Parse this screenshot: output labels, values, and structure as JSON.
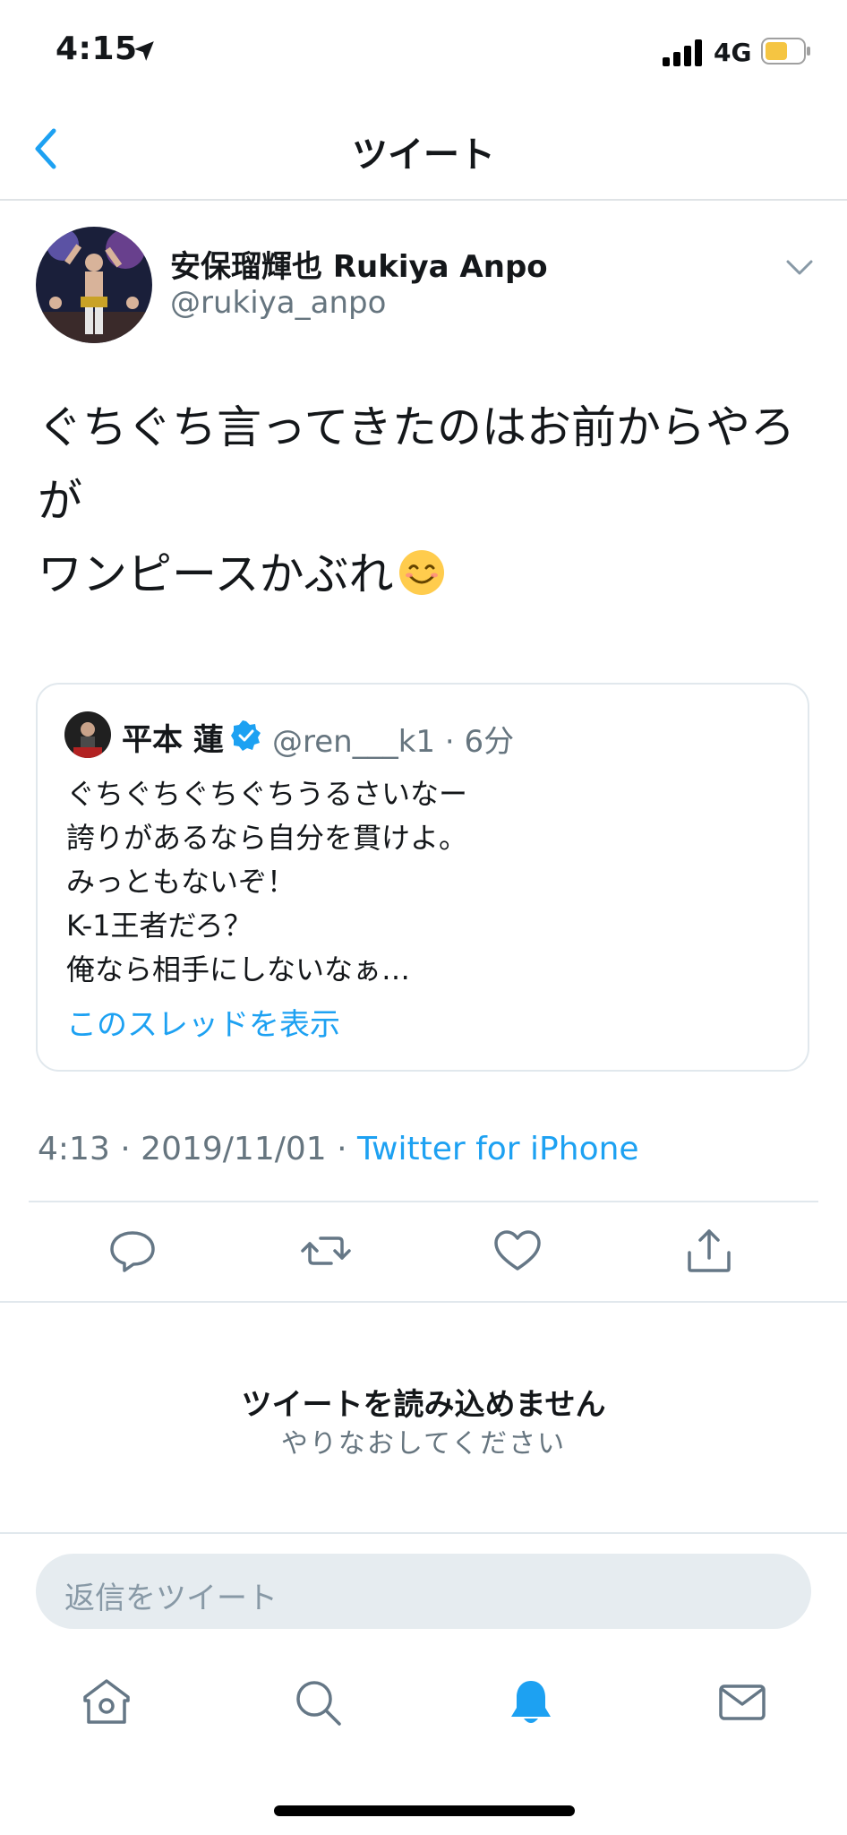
{
  "status_bar": {
    "time": "4:15",
    "network": "4G",
    "battery_color": "#f5c542"
  },
  "nav": {
    "title": "ツイート",
    "back_icon": "chevron-left-icon"
  },
  "tweet": {
    "author_name": "安保瑠輝也 Rukiya Anpo",
    "author_handle": "@rukiya_anpo",
    "text": "ぐちぐち言ってきたのはお前からやろが\nワンピースかぶれ",
    "emoji": "smiling-face-icon",
    "timestamp": "4:13 · 2019/11/01 · ",
    "source": "Twitter for iPhone"
  },
  "quote": {
    "name": "平本 蓮",
    "handle_time": "@ren___k1 · 6分",
    "text": "ぐちぐちぐちぐちうるさいなー\n誇りがあるなら自分を貫けよ。\nみっともないぞ！\nK-1王者だろ？\n俺なら相手にしないなぁ…",
    "thread_link": "このスレッドを表示"
  },
  "actions": [
    "reply-icon",
    "retweet-icon",
    "like-icon",
    "share-icon"
  ],
  "load_error": {
    "title": "ツイートを読み込めません",
    "subtitle": "やりなおしてください"
  },
  "reply_box": {
    "placeholder": "返信をツイート"
  },
  "tabs": [
    "home-icon",
    "search-icon",
    "notifications-icon",
    "messages-icon"
  ],
  "colors": {
    "accent": "#1da1f2",
    "secondary_text": "#66757f",
    "divider": "#e1e8ed"
  }
}
